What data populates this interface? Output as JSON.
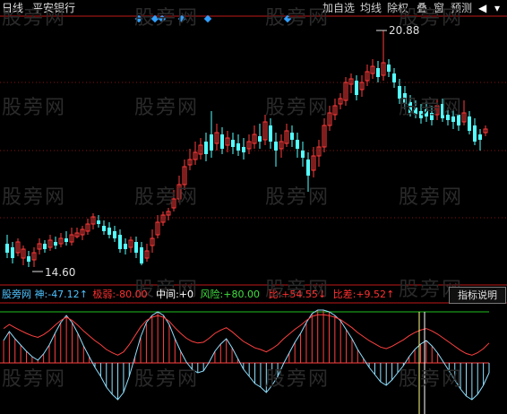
{
  "toolbar": {
    "period": "日线",
    "stock_name": "平安银行",
    "buttons": [
      "加自选",
      "均线",
      "除权",
      "叠",
      "窗",
      "预测"
    ],
    "back_arrow": "◀",
    "menu_arrow": "▾"
  },
  "watermark_text": "股旁网",
  "main_chart": {
    "high_label": "20.88",
    "low_label": "14.60",
    "signal_markers": 5
  },
  "indicator": {
    "name": "股旁网",
    "items": [
      {
        "label": "神:",
        "value": "-47.12",
        "suffix": "↑",
        "color": "#4fc3ff"
      },
      {
        "label": "极弱:",
        "value": "-80.00",
        "suffix": "",
        "color": "#ff3030"
      },
      {
        "label": "中间:",
        "value": "+0",
        "suffix": "",
        "color": "#ffffff"
      },
      {
        "label": "风险:",
        "value": "+80.00",
        "suffix": "",
        "color": "#40e040"
      },
      {
        "label": "比:",
        "value": "+54.55",
        "suffix": "↓",
        "color": "#ff3030"
      },
      {
        "label": "比差:",
        "value": "+9.52",
        "suffix": "↑",
        "color": "#ff3030"
      }
    ],
    "button_label": "指标说明"
  },
  "colors": {
    "up": "#ff3b3b",
    "down": "#54ffff",
    "grid": "#8a1010",
    "line_blue": "#8fe0ff",
    "line_red": "#ff4040",
    "line_green": "#20c020",
    "marker": "#30a0ff"
  }
}
